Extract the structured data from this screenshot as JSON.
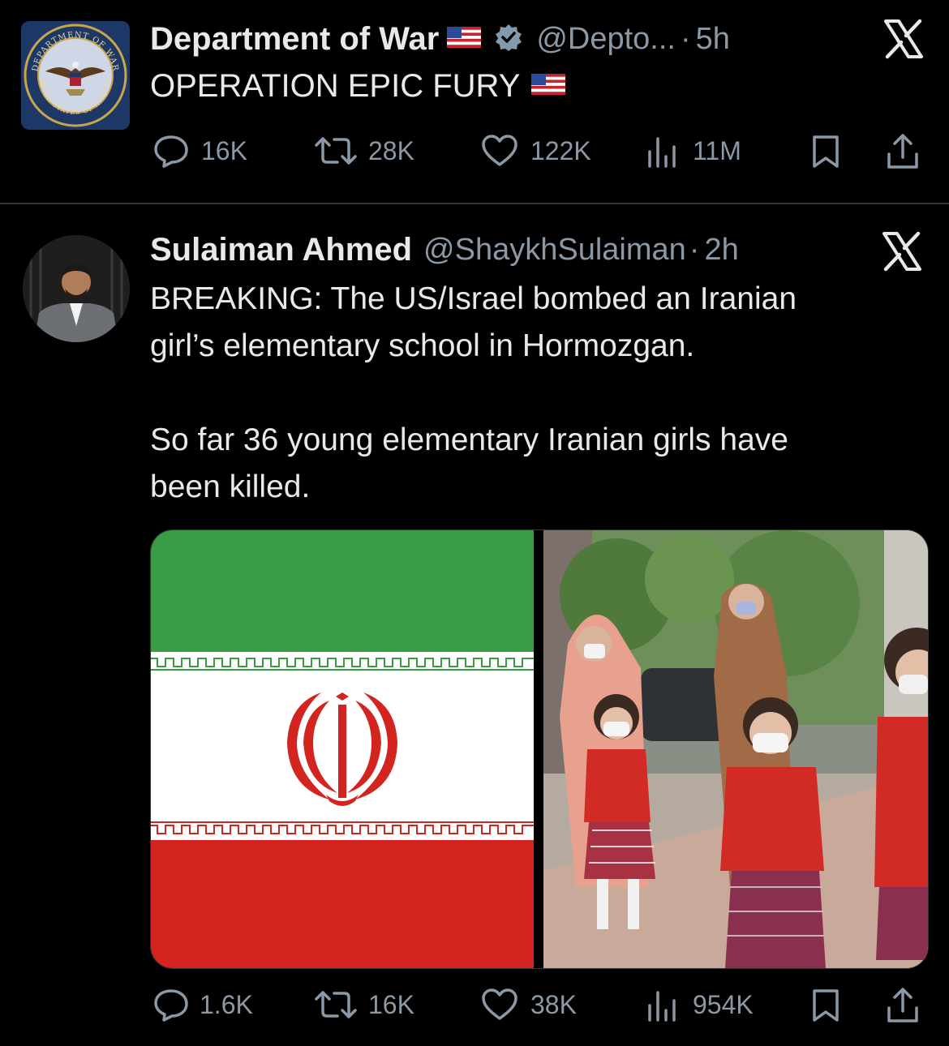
{
  "tweets": [
    {
      "author": "Department of War",
      "handle": "@Depto...",
      "dot": "·",
      "time": "5h",
      "text": "OPERATION EPIC FURY",
      "metrics": {
        "replies": "16K",
        "reposts": "28K",
        "likes": "122K",
        "views": "11M"
      }
    },
    {
      "author": "Sulaiman Ahmed",
      "handle": "@ShaykhSulaiman",
      "dot": "·",
      "time": "2h",
      "text_line1": "BREAKING: The US/Israel bombed an Iranian",
      "text_line2": "girl’s elementary school in Hormozgan.",
      "text_line3": "So far 36 young elementary Iranian girls have",
      "text_line4": "been killed.",
      "metrics": {
        "replies": "1.6K",
        "reposts": "16K",
        "likes": "38K",
        "views": "954K"
      }
    }
  ],
  "seal": {
    "top": "DEPARTMENT OF WAR",
    "bottom": "UNITED STATES OF AMERICA"
  },
  "colors": {
    "background": "#000000",
    "text": "#e7e9ea",
    "muted": "#8b98a5",
    "divider": "#2f3336",
    "iran_green": "#3a9b45",
    "iran_red": "#d3241f"
  }
}
